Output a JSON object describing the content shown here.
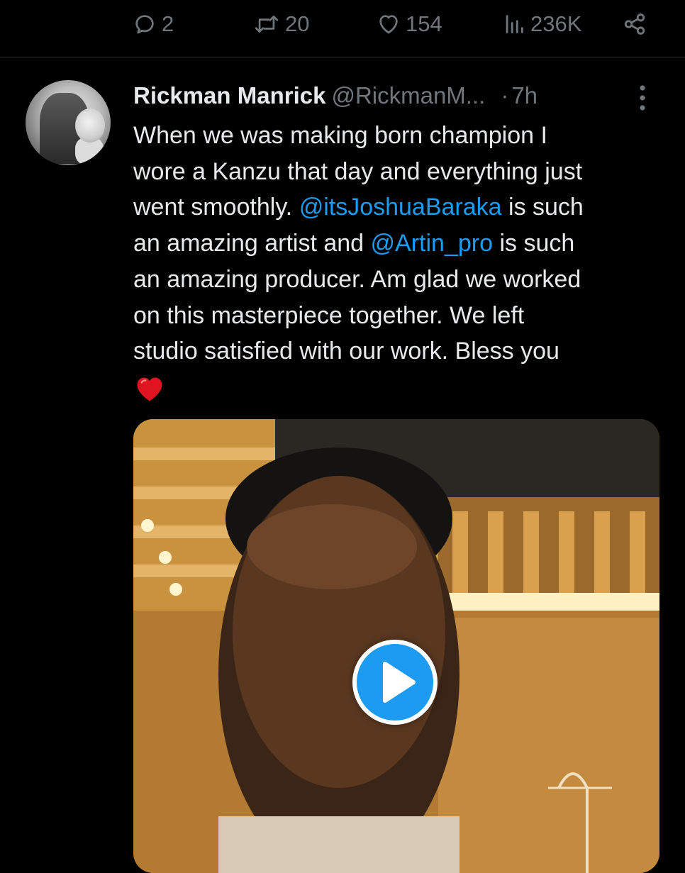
{
  "previous_tweet_actions": {
    "reply": {
      "icon": "reply-icon",
      "count": "2"
    },
    "retweet": {
      "icon": "retweet-icon",
      "count": "20"
    },
    "like": {
      "icon": "heart-outline-icon",
      "count": "154"
    },
    "views": {
      "icon": "views-icon",
      "count": "236K"
    },
    "share": {
      "icon": "share-icon"
    }
  },
  "tweet": {
    "display_name": "Rickman Manrick",
    "handle": "@RickmanM...",
    "separator": "·",
    "time": "7h",
    "text_lines": [
      [
        "When we was making born champion I"
      ],
      [
        "wore a Kanzu that day and everything just"
      ],
      [
        "went smoothly. ",
        "@itsJoshuaBaraka",
        " is such"
      ],
      [
        "an amazing artist and ",
        "@Artin_pro",
        " is such"
      ],
      [
        "an amazing producer. Am glad we worked"
      ],
      [
        "on this masterpiece together. We left"
      ],
      [
        "studio satisfied with our work. Bless you"
      ]
    ],
    "emoji": "red-heart-icon",
    "media": {
      "type": "video",
      "icon": "play-icon"
    }
  },
  "colors": {
    "background": "#000000",
    "text": "#e7e9ea",
    "muted": "#71767b",
    "accent": "#1d9bf0",
    "divider": "#2f3336",
    "heart": "#f91880"
  }
}
